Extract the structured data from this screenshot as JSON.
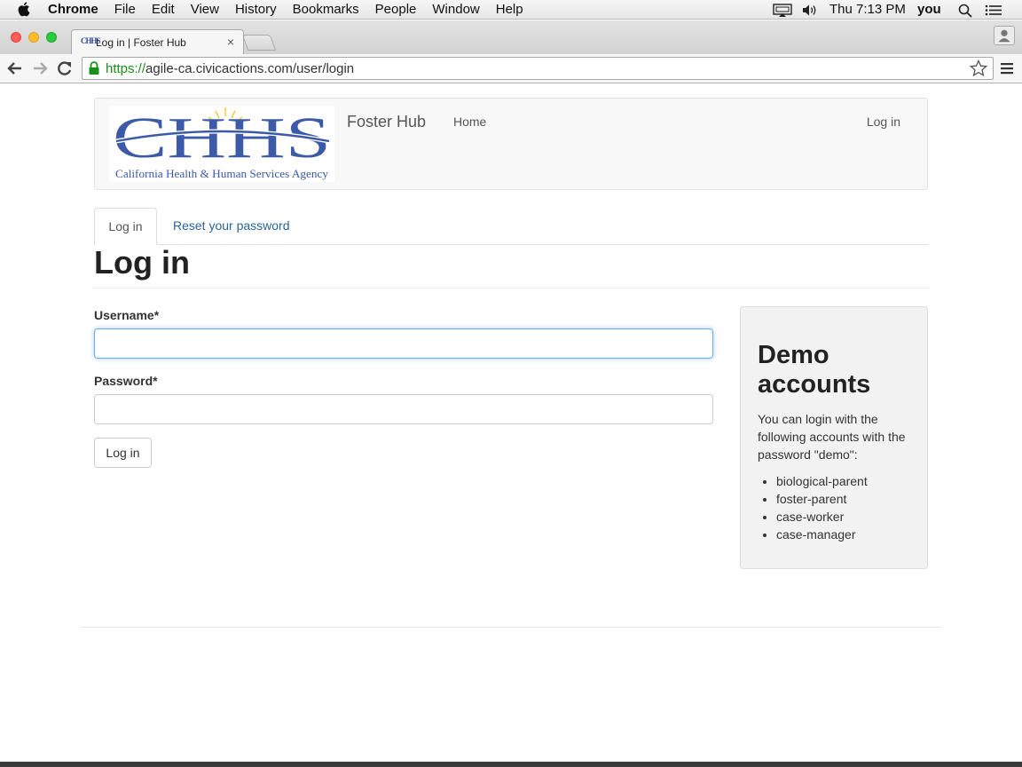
{
  "menubar": {
    "app_name": "Chrome",
    "items": [
      "File",
      "Edit",
      "View",
      "History",
      "Bookmarks",
      "People",
      "Window",
      "Help"
    ],
    "clock": "Thu 7:13 PM",
    "user": "you"
  },
  "browser": {
    "tab_title": "Log in | Foster Hub",
    "tab_favicon_text": "CHHS",
    "url_scheme": "https://",
    "url_rest": "agile-ca.civicactions.com/user/login"
  },
  "site": {
    "logo_letters": "CHHS",
    "logo_caption": "California Health & Human Services Agency",
    "name": "Foster Hub",
    "nav_home": "Home",
    "nav_login": "Log in"
  },
  "tabs": {
    "active": "Log in",
    "reset": "Reset your password"
  },
  "page_title": "Log in",
  "form": {
    "username_label": "Username*",
    "username_value": "",
    "password_label": "Password*",
    "password_value": "",
    "submit_label": "Log in"
  },
  "demo": {
    "title": "Demo accounts",
    "description": "You can login with the following accounts with the password \"demo\":",
    "accounts": [
      "biological-parent",
      "foster-parent",
      "case-worker",
      "case-manager"
    ]
  }
}
